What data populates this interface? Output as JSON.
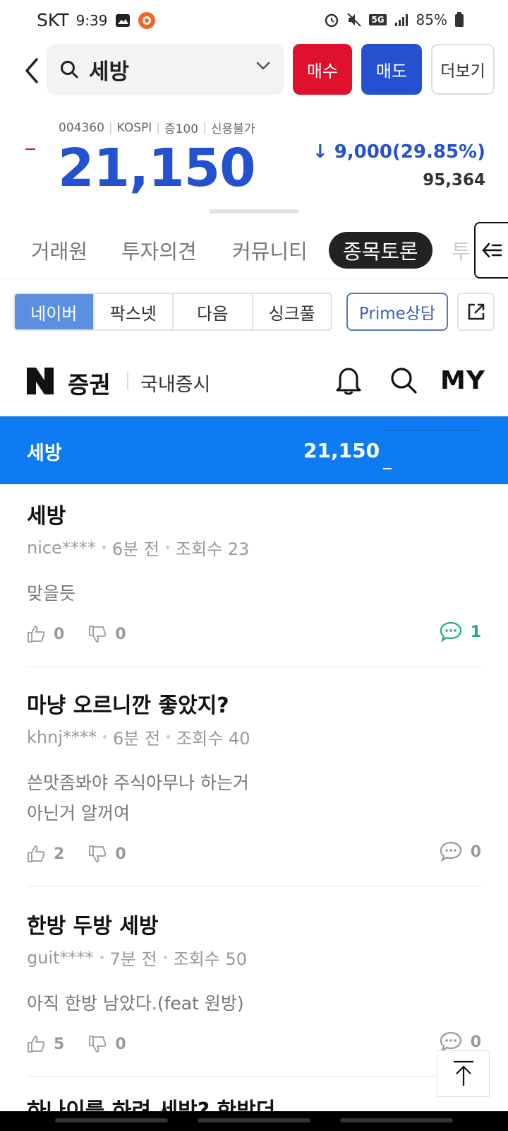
{
  "status": {
    "carrier": "SKT",
    "time": "9:39",
    "network": "5G",
    "battery": "85%"
  },
  "search": {
    "query": "세방"
  },
  "actions": {
    "buy": "매수",
    "sell": "매도",
    "more": "더보기"
  },
  "stock": {
    "code": "004360",
    "market": "KOSPI",
    "margin": "증100",
    "credit": "신용불가",
    "price": "21,150",
    "change": "↓ 9,000(29.85%)",
    "volume": "95,364"
  },
  "tabs": [
    "거래원",
    "투자의견",
    "커뮤니티",
    "종목토론",
    "투"
  ],
  "sources": [
    "네이버",
    "팍스넷",
    "다음",
    "싱크풀"
  ],
  "prime": "Prime상담",
  "naver": {
    "brand": "증권",
    "section": "국내증시",
    "my": "MY"
  },
  "ticker": {
    "name": "세방",
    "price": "21,150"
  },
  "posts": [
    {
      "title": "세방",
      "author": "nice****",
      "time": "6분 전",
      "views": "조회수 23",
      "body": [
        "맞을듯"
      ],
      "likes": "0",
      "dislikes": "0",
      "comments": "1"
    },
    {
      "title": "마냥 오르니깐 좋았지?",
      "author": "khnj****",
      "time": "6분 전",
      "views": "조회수 40",
      "body": [
        "쓴맛좀봐야 주식아무나 하는거",
        "아닌거 알꺼여"
      ],
      "likes": "2",
      "dislikes": "0",
      "comments": "0"
    },
    {
      "title": "한방 두방 세방",
      "author": "guit****",
      "time": "7분 전",
      "views": "조회수 50",
      "body": [
        "아직 한방 남았다.(feat 원방)"
      ],
      "likes": "5",
      "dislikes": "0",
      "comments": "0"
    }
  ],
  "peek_title": "하나이를 하려 세방? 한방더",
  "colors": {
    "buy": "#e0112d",
    "sell": "#2451d0",
    "banner": "#0f7bf2",
    "comment_active": "#1fae77"
  }
}
